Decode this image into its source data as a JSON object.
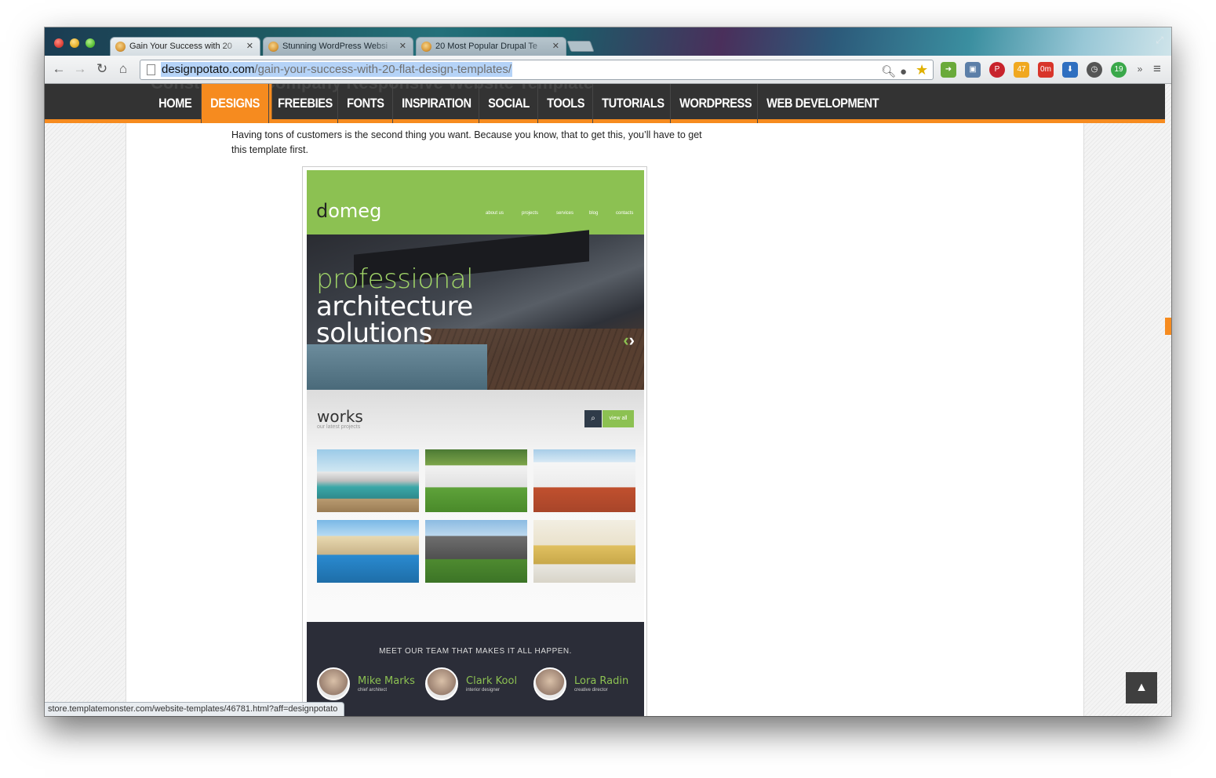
{
  "tabs": [
    {
      "label": "Gain Your Success with 20",
      "active": true
    },
    {
      "label": "Stunning WordPress Websi",
      "active": false
    },
    {
      "label": "20 Most Popular Drupal Te",
      "active": false
    }
  ],
  "toolbar": {
    "back_icon": "back-arrow-icon",
    "url_host": "designpotato.com",
    "url_path": "/gain-your-success-with-20-flat-design-templates/"
  },
  "extensions": {
    "weather_temp": "47",
    "badge_om": "0m",
    "badge_19": "19"
  },
  "site_nav": {
    "ghost_heading": "Construction Company Responsive Website Template",
    "items": [
      {
        "label": "HOME",
        "active": false
      },
      {
        "label": "DESIGNS",
        "active": true
      },
      {
        "label": "FREEBIES",
        "active": false
      },
      {
        "label": "FONTS",
        "active": false
      },
      {
        "label": "INSPIRATION",
        "active": false
      },
      {
        "label": "SOCIAL",
        "active": false
      },
      {
        "label": "TOOLS",
        "active": false
      },
      {
        "label": "TUTORIALS",
        "active": false
      },
      {
        "label": "WORDPRESS",
        "active": false
      },
      {
        "label": "WEB DEVELOPMENT",
        "active": false
      }
    ]
  },
  "article": {
    "paragraph": "Having tons of customers is the second thing you want. Because you know, that to get this, you’ll have to get this template first."
  },
  "preview": {
    "logo_first": "d",
    "logo_rest": "omeg",
    "menu": [
      "about us",
      "projects",
      "services",
      "blog",
      "contacts"
    ],
    "hero_line1": "professional",
    "hero_line2": "architecture",
    "hero_line3": "solutions",
    "works_title": "works",
    "works_sub": "our latest projects",
    "view_all": "view all",
    "team_title": "MEET OUR TEAM THAT MAKES IT ALL HAPPEN.",
    "team": [
      {
        "name": "Mike Marks",
        "role": "chief architect"
      },
      {
        "name": "Clark Kool",
        "role": "interior designer"
      },
      {
        "name": "Lora Radin",
        "role": "creative director"
      }
    ]
  },
  "status_url": "store.templatemonster.com/website-templates/46781.html?aff=designpotato",
  "colors": {
    "accent": "#f68b1f",
    "nav_bg": "#333333",
    "preview_green": "#8cc152"
  }
}
